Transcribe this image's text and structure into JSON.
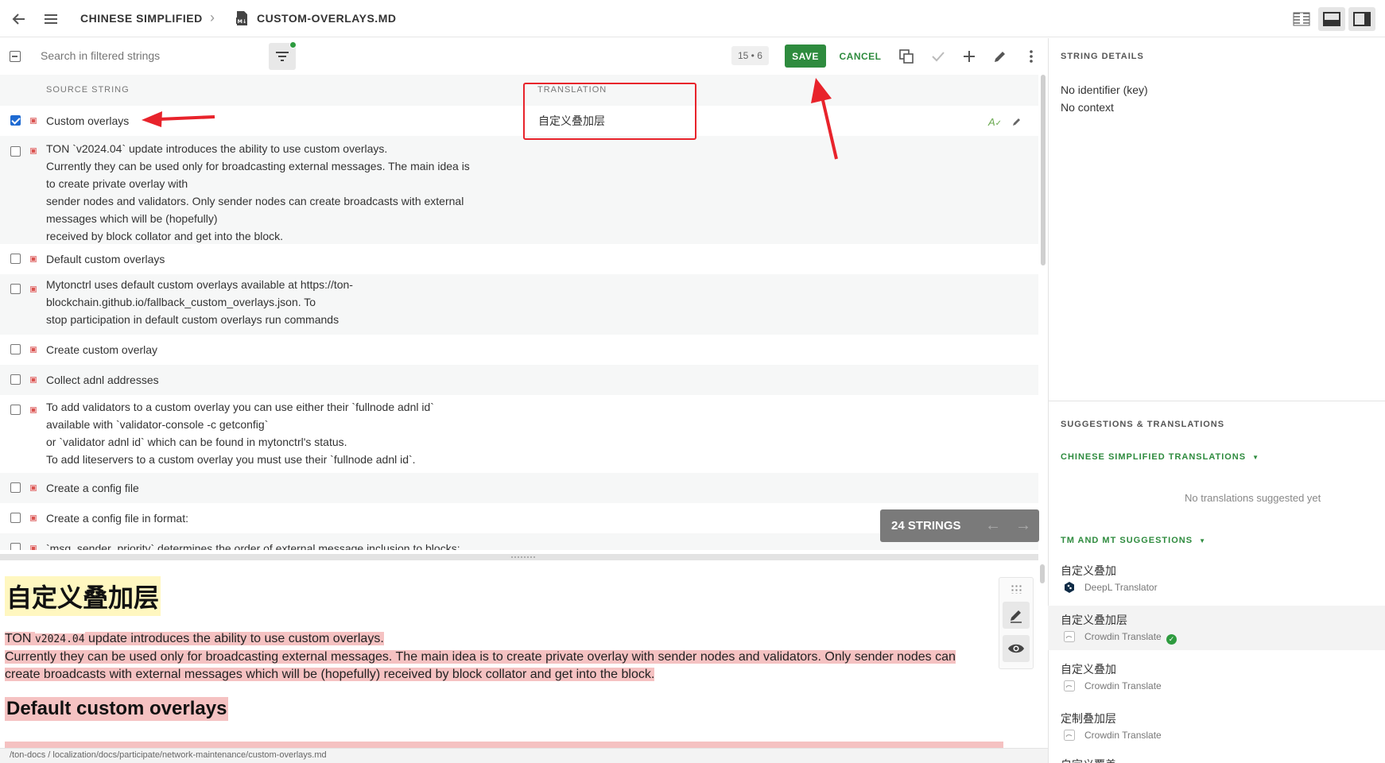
{
  "header": {
    "language": "CHINESE SIMPLIFIED",
    "file": "CUSTOM-OVERLAYS.MD",
    "file_ext": "MD"
  },
  "toolbar": {
    "search_placeholder": "Search in filtered strings",
    "counter": "15 • 6",
    "save_label": "SAVE",
    "cancel_label": "CANCEL"
  },
  "list": {
    "col_source": "SOURCE STRING",
    "col_translation": "TRANSLATION",
    "rows": [
      {
        "text": "Custom overlays",
        "checked": true,
        "translation": "自定义叠加层"
      },
      {
        "text": "TON `v2024.04` update introduces the ability to use custom overlays.\nCurrently they can be used only for broadcasting external messages. The main idea is\nto create private overlay with\nsender nodes and validators. Only sender nodes can create broadcasts with external\nmessages which will be (hopefully)\nreceived by block collator and get into the block."
      },
      {
        "text": "Default custom overlays"
      },
      {
        "text": "Mytonctrl uses default custom overlays available at https://ton-\nblockchain.github.io/fallback_custom_overlays.json. To\nstop participation in default custom overlays run commands"
      },
      {
        "text": "Create custom overlay"
      },
      {
        "text": "Collect adnl addresses"
      },
      {
        "text": "To add validators to a custom overlay you can use either their `fullnode adnl id`\navailable with `validator-console -c getconfig`\nor `validator adnl id` which can be found in mytonctrl's status.\nTo add liteservers to a custom overlay you must use their `fullnode adnl id`."
      },
      {
        "text": "Create a config file"
      },
      {
        "text": "Create a config file in format:"
      },
      {
        "text": "`msg_sender_priority` determines the order of external message inclusion to blocks:"
      }
    ],
    "strings_badge": "24 STRINGS"
  },
  "preview": {
    "h1": "自定义叠加层",
    "p_part1": "TON ",
    "p_code": "v2024.04",
    "p_part2": " update introduces the ability to use custom overlays.",
    "p_line2": "Currently they can be used only for broadcasting external messages. The main idea is to create private overlay with sender nodes and validators. Only sender nodes can",
    "p_line3": "create broadcasts with external messages which will be (hopefully) received by block collator and get into the block.",
    "h2": "Default custom overlays",
    "path": "/ton-docs / localization/docs/participate/network-maintenance/custom-overlays.md"
  },
  "details": {
    "title": "STRING DETAILS",
    "identifier": "No identifier (key)",
    "context": "No context"
  },
  "suggestions": {
    "title": "SUGGESTIONS & TRANSLATIONS",
    "translations_link": "CHINESE SIMPLIFIED TRANSLATIONS",
    "none": "No translations suggested yet",
    "tm_link": "TM AND MT SUGGESTIONS",
    "items": [
      {
        "text": "自定义叠加",
        "source": "DeepL Translator"
      },
      {
        "text": "自定义叠加层",
        "source": "Crowdin Translate",
        "verified": true
      },
      {
        "text": "自定义叠加",
        "source": "Crowdin Translate"
      },
      {
        "text": "定制叠加层",
        "source": "Crowdin Translate"
      },
      {
        "text": "自定义覆盖"
      }
    ]
  },
  "colors": {
    "accent": "#2e8b3e",
    "annotation": "#e8232b",
    "selected": "#1e6ad2"
  }
}
